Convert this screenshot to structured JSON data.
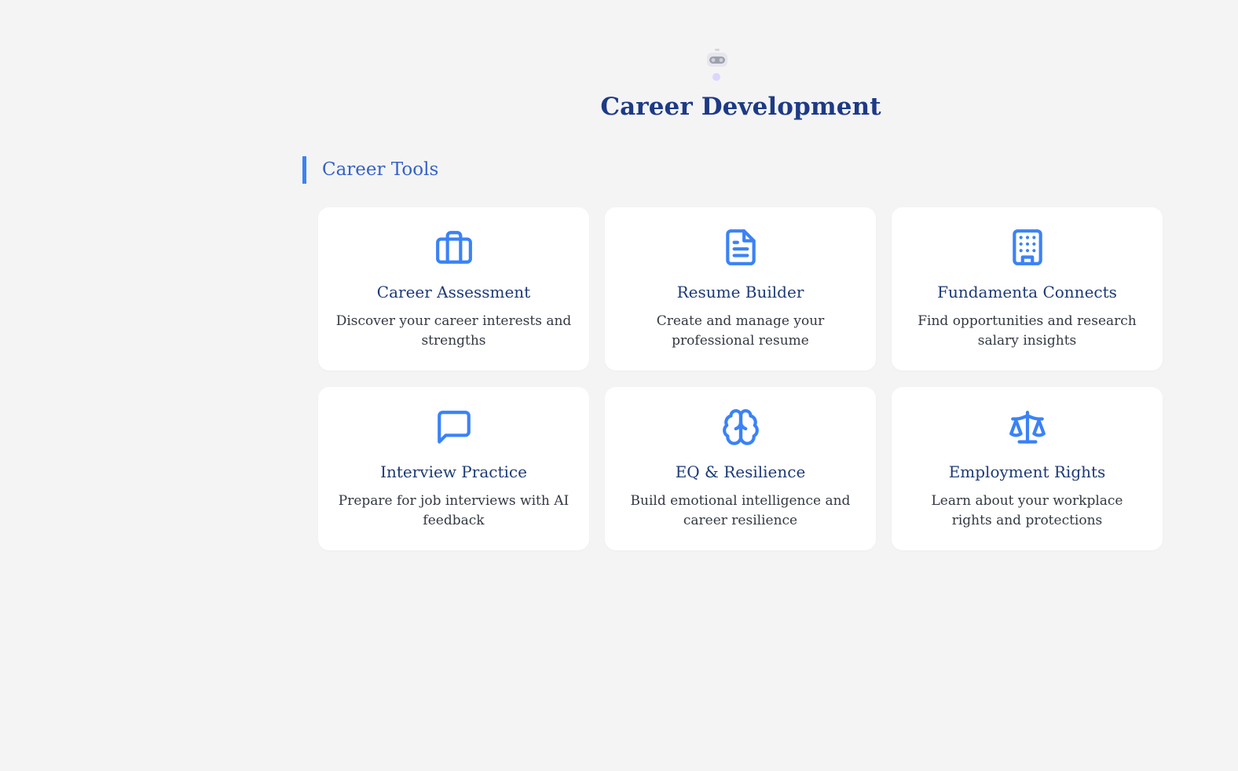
{
  "header": {
    "mascot_icon": "robot-icon",
    "title": "Career Development"
  },
  "section": {
    "heading": "Career Tools"
  },
  "cards": [
    {
      "icon": "briefcase-icon",
      "title": "Career Assessment",
      "description": "Discover your career interests and strengths"
    },
    {
      "icon": "document-icon",
      "title": "Resume Builder",
      "description": "Create and manage your professional resume"
    },
    {
      "icon": "building-icon",
      "title": "Fundamenta Connects",
      "description": "Find opportunities and research salary insights"
    },
    {
      "icon": "chat-bubble-icon",
      "title": "Interview Practice",
      "description": "Prepare for job interviews with AI feedback"
    },
    {
      "icon": "brain-icon",
      "title": "EQ & Resilience",
      "description": "Build emotional intelligence and career resilience"
    },
    {
      "icon": "scale-icon",
      "title": "Employment Rights",
      "description": "Learn about your workplace rights and protections"
    }
  ],
  "colors": {
    "accent": "#3b82f6",
    "title": "#1d3a85",
    "card_title": "#1d3a75",
    "section_heading": "#3562c8",
    "background": "#f4f4f4"
  }
}
